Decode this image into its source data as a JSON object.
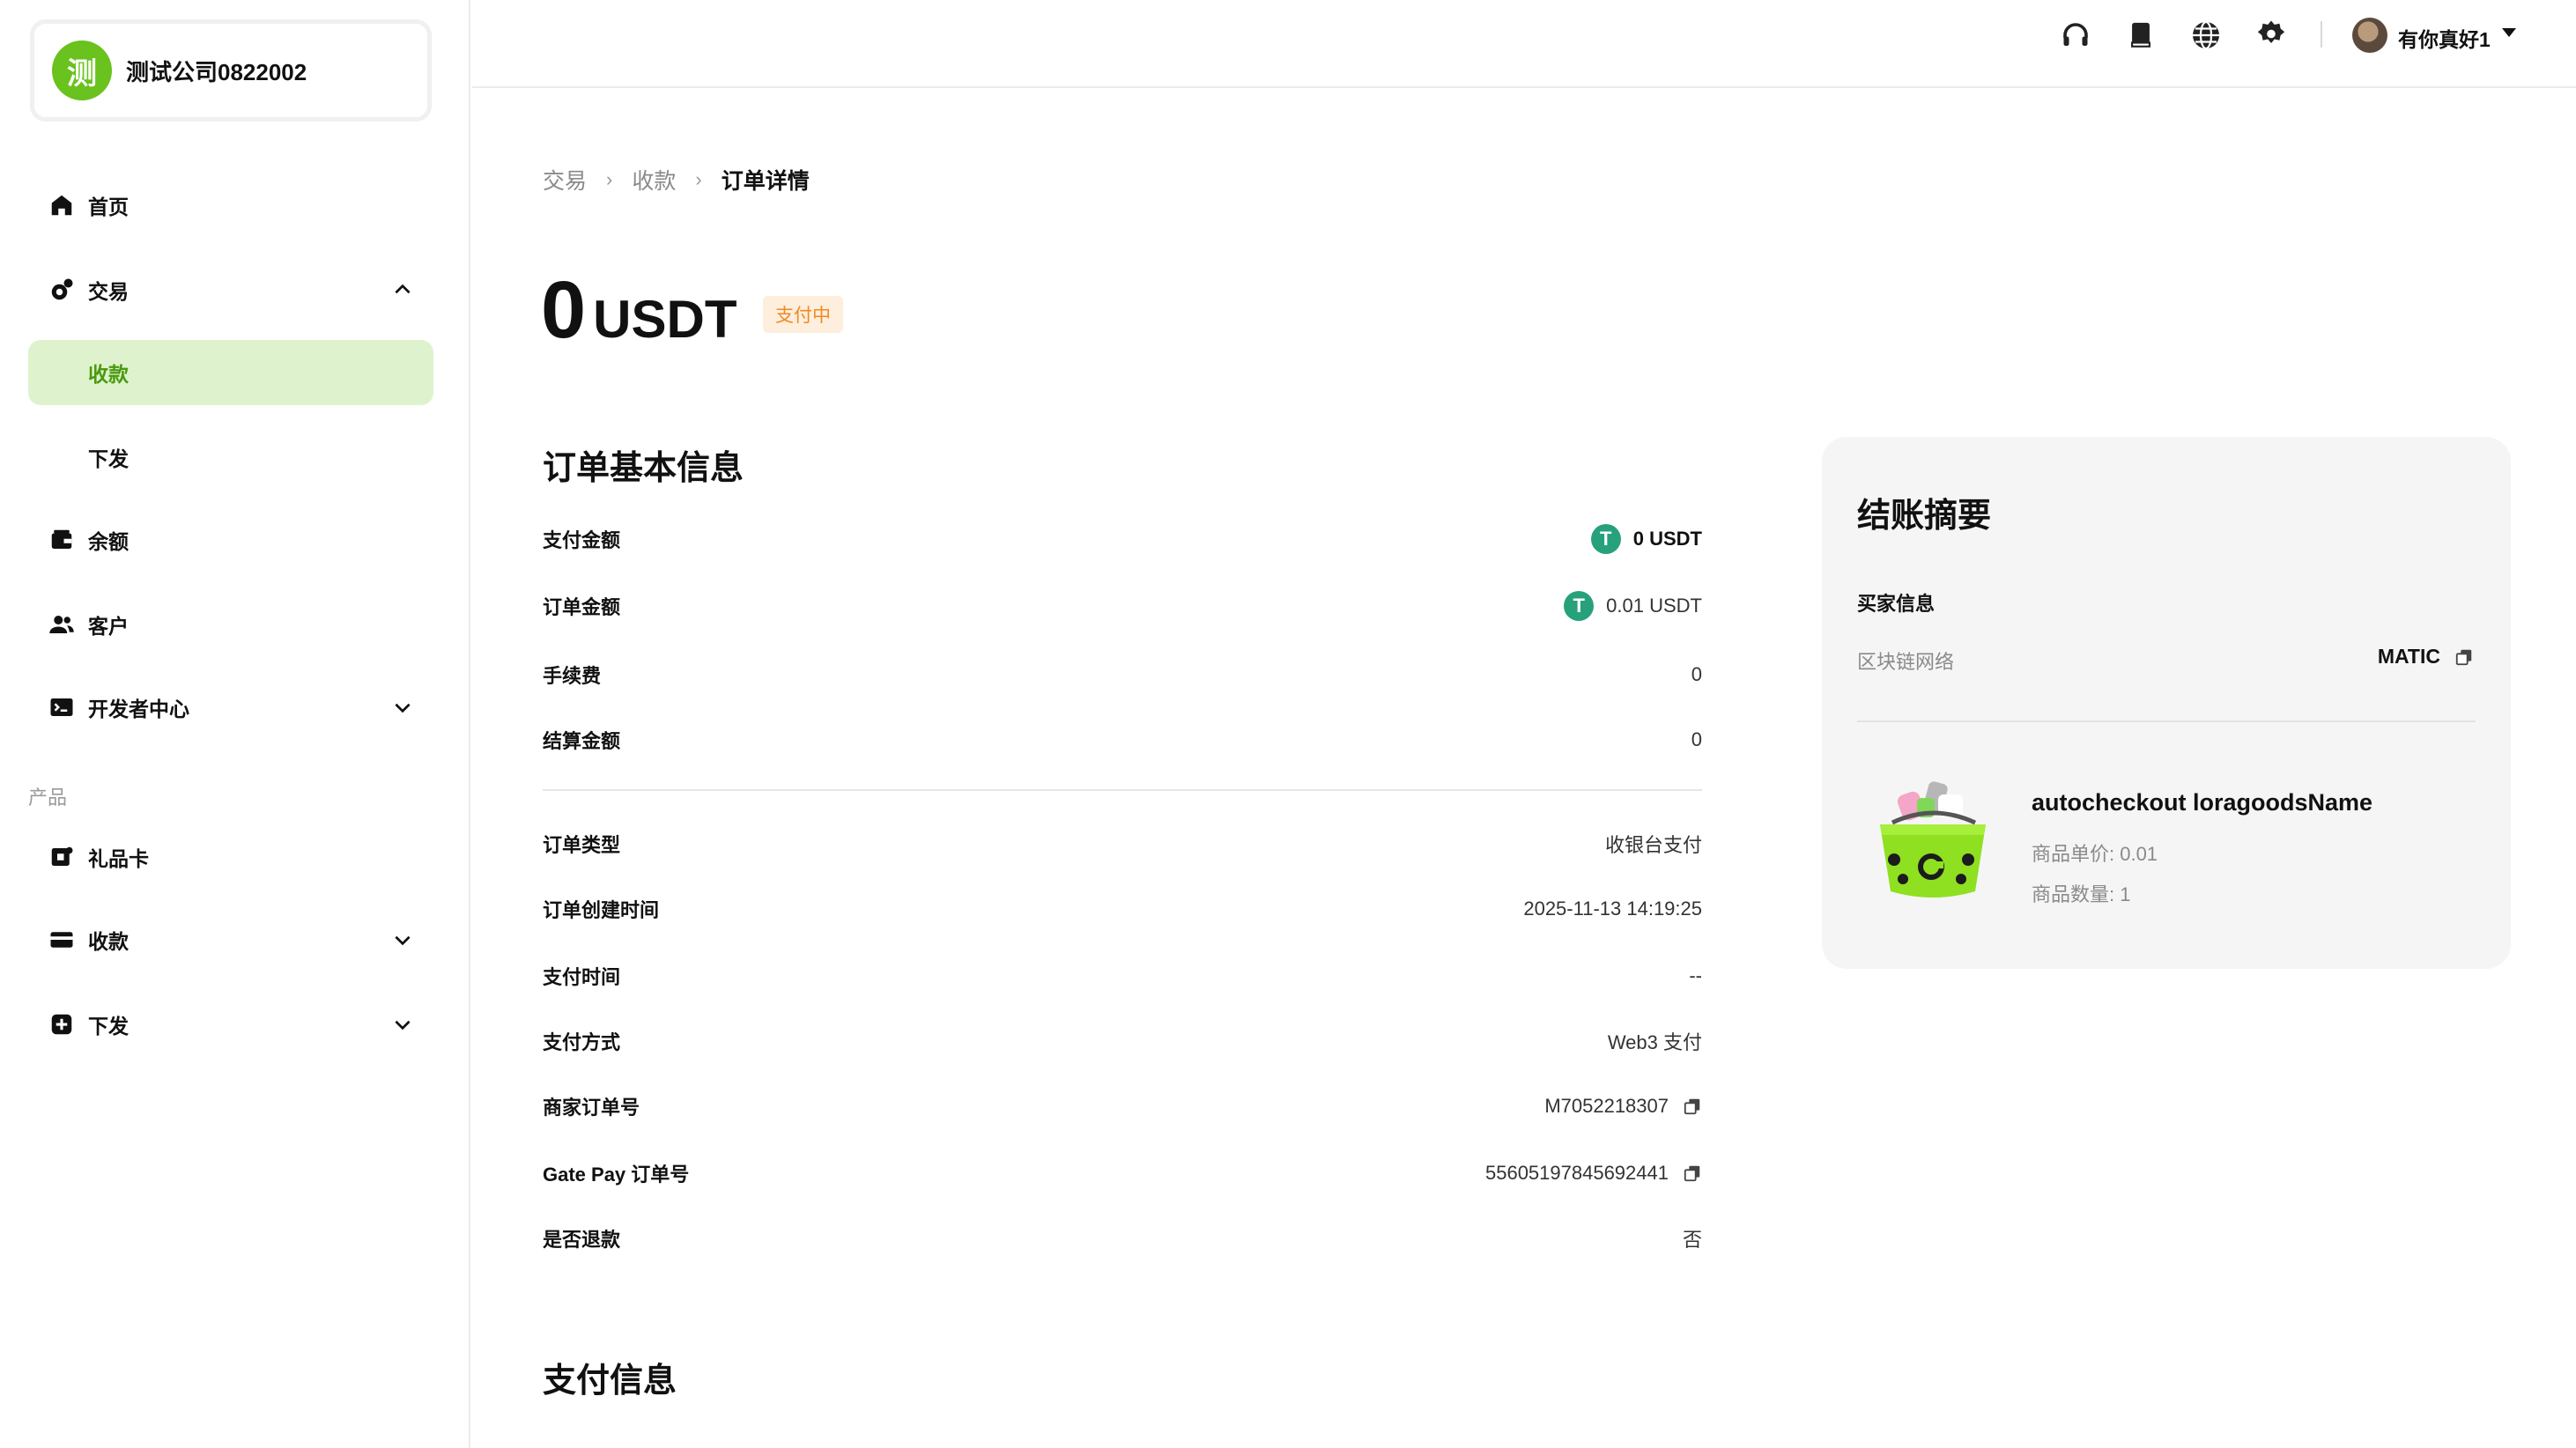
{
  "company": {
    "avatar_char": "测",
    "name": "测试公司0822002"
  },
  "sidebar": {
    "items": [
      {
        "label": "首页",
        "icon": "home-icon"
      },
      {
        "label": "交易",
        "icon": "transaction-icon",
        "expanded": true
      },
      {
        "label": "收款",
        "active": true
      },
      {
        "label": "下发"
      },
      {
        "label": "余额",
        "icon": "wallet-icon"
      },
      {
        "label": "客户",
        "icon": "users-icon"
      },
      {
        "label": "开发者中心",
        "icon": "terminal-icon"
      }
    ],
    "section_label": "产品",
    "product_items": [
      {
        "label": "礼品卡",
        "icon": "gift-card-icon"
      },
      {
        "label": "收款",
        "icon": "card-icon"
      },
      {
        "label": "下发",
        "icon": "payout-icon"
      }
    ]
  },
  "topbar": {
    "user_name": "有你真好1"
  },
  "breadcrumb": [
    "交易",
    "收款",
    "订单详情"
  ],
  "amount": {
    "value": "0",
    "currency": "USDT",
    "status": "支付中"
  },
  "order_info": {
    "title": "订单基本信息",
    "rows": [
      {
        "label": "支付金额",
        "value": "0 USDT"
      },
      {
        "label": "订单金额",
        "value": "0.01 USDT"
      },
      {
        "label": "手续费",
        "value": "0"
      },
      {
        "label": "结算金额",
        "value": "0"
      },
      {
        "label": "订单类型",
        "value": "收银台支付"
      },
      {
        "label": "订单创建时间",
        "value": "2025-11-13 14:19:25"
      },
      {
        "label": "支付时间",
        "value": "--"
      },
      {
        "label": "支付方式",
        "value": "Web3 支付"
      },
      {
        "label": "商家订单号",
        "value": "M7052218307"
      },
      {
        "label": "Gate Pay 订单号",
        "value": "55605197845692441"
      },
      {
        "label": "是否退款",
        "value": "否"
      }
    ]
  },
  "payment_info": {
    "title": "支付信息"
  },
  "summary": {
    "title": "结账摘要",
    "buyer_label": "买家信息",
    "chain_label": "区块链网络",
    "chain_value": "MATIC",
    "product_name": "autocheckout loragoodsName",
    "unit_price": "商品单价: 0.01",
    "quantity": "商品数量: 1"
  },
  "colors": {
    "accent": "#69c21d",
    "active_bg": "#def3cd",
    "active_text": "#4a9a10",
    "usdt": "#26a17b",
    "status_bg": "#fdeedd",
    "status_text": "#f08a24"
  }
}
